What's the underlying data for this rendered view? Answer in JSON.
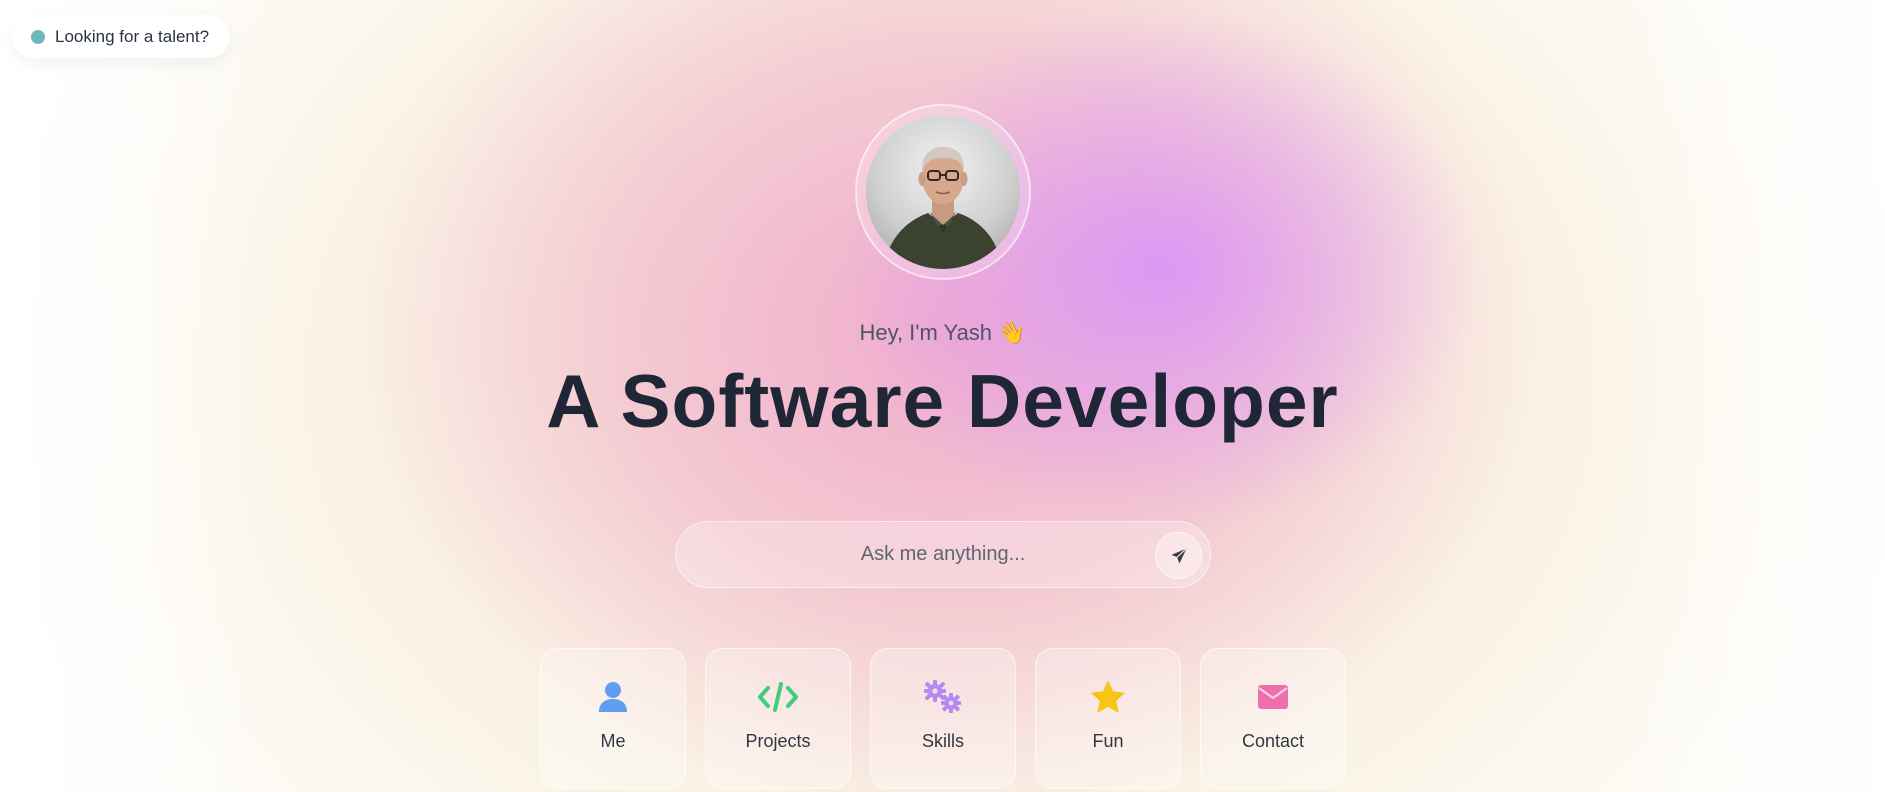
{
  "talent_pill": {
    "label": "Looking for a talent?",
    "dot_color": "#6fb8ba"
  },
  "hero": {
    "avatar_alt": "Profile photo",
    "greeting": "Hey, I'm Yash 👋",
    "headline": "A Software Developer"
  },
  "ask": {
    "placeholder": "Ask me anything...",
    "send_icon": "paper-plane-icon"
  },
  "nav_cards": [
    {
      "label": "Me",
      "icon": "user-icon",
      "color": "#5f9ef0"
    },
    {
      "label": "Projects",
      "icon": "code-icon",
      "color": "#3ecf78"
    },
    {
      "label": "Skills",
      "icon": "gears-icon",
      "color": "#b48af2"
    },
    {
      "label": "Fun",
      "icon": "star-icon",
      "color": "#f6c516"
    },
    {
      "label": "Contact",
      "icon": "envelope-icon",
      "color": "#ef6fae"
    }
  ]
}
